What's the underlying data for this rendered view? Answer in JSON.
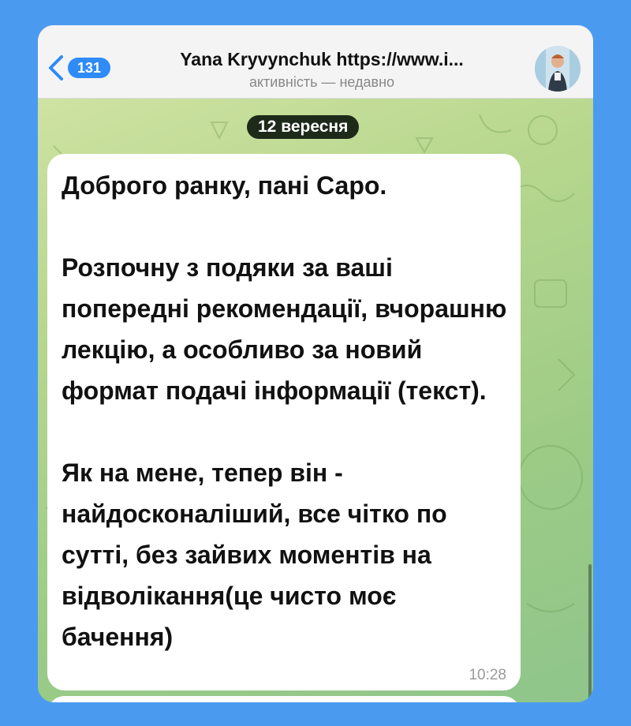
{
  "header": {
    "unread_count": "131",
    "title": "Yana Kryvynchuk https://www.i...",
    "status": "активність — недавно"
  },
  "chat": {
    "date_label": "12 вересня",
    "message": {
      "text": "Доброго ранку, пані Саро.\n\nРозпочну з подяки за ваші попередні рекомендації, вчорашню лекцію, а особливо за новий формат подачі інформації (текст).\n\nЯк на мене, тепер він - найдосконаліший, все чітко по сутті, без зайвих моментів на відволікання(це чисто моє бачення)",
      "time": "10:28"
    }
  },
  "colors": {
    "frame": "#4a9bf0",
    "accent": "#2f8bf5",
    "header_bg": "#f4f4f4",
    "chat_bg_start": "#d6e6a8",
    "chat_bg_end": "#8fc58b",
    "bubble_bg": "#ffffff"
  },
  "icons": {
    "back": "chevron-left-icon",
    "avatar": "user-avatar-photo"
  }
}
